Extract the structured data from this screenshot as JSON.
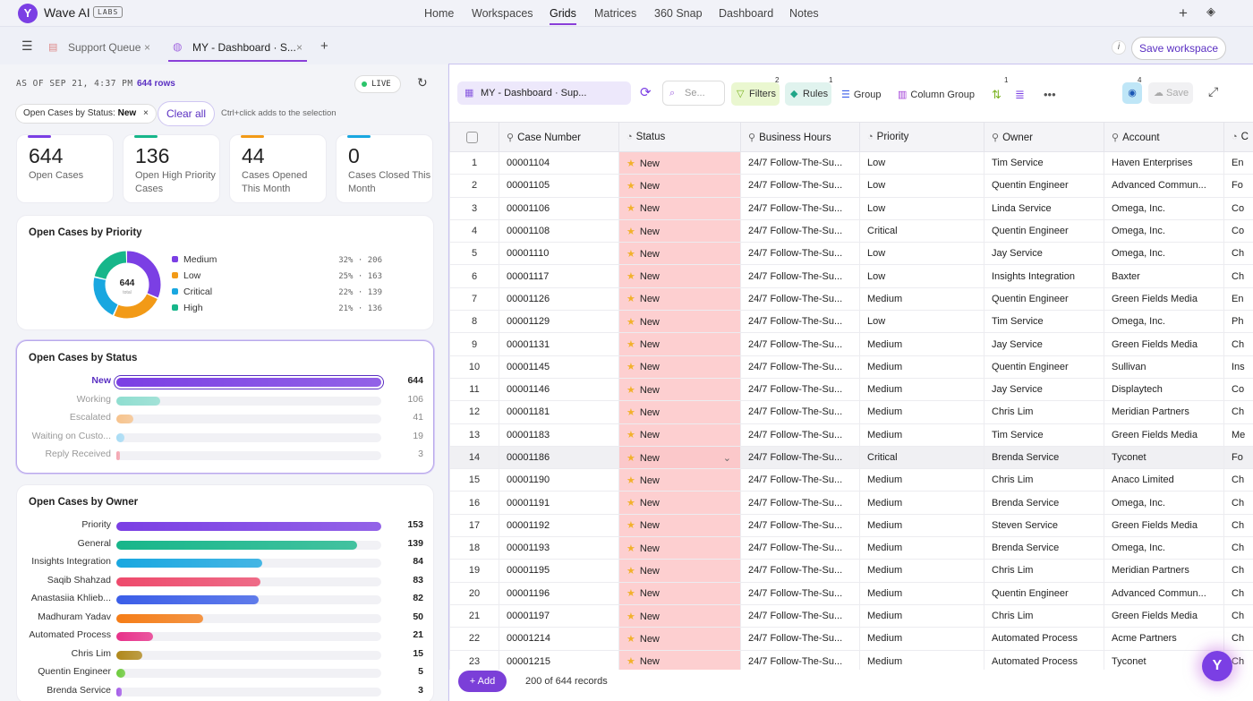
{
  "app": {
    "name": "Wave AI",
    "badge": "LABS"
  },
  "nav": [
    "Home",
    "Workspaces",
    "Grids",
    "Matrices",
    "360 Snap",
    "Dashboard",
    "Notes"
  ],
  "tabs": [
    {
      "label": "Support Queue",
      "active": false
    },
    {
      "label": "MY - Dashboard · S...",
      "active": true
    }
  ],
  "save_workspace": "Save workspace",
  "left": {
    "as_of": "AS OF SEP 21, 4:37 PM",
    "rows": "644 rows",
    "live": "LIVE",
    "filter_chip_label": "Open Cases by Status:",
    "filter_chip_value": "New",
    "clear_all": "Clear all",
    "hint": "Ctrl+click adds to the selection",
    "kpis": [
      {
        "value": "644",
        "label": "Open Cases",
        "color": "#7b3fe4"
      },
      {
        "value": "136",
        "label": "Open High Priority Cases",
        "color": "#17b68a"
      },
      {
        "value": "44",
        "label": "Cases Opened This Month",
        "color": "#f29a17"
      },
      {
        "value": "0",
        "label": "Cases Closed This Month",
        "color": "#19a7e0"
      }
    ],
    "priority_card": {
      "title": "Open Cases by Priority",
      "center_value": "644",
      "center_label": "total",
      "items": [
        {
          "name": "Medium",
          "pct": 32,
          "text": "32% · 206",
          "color": "#7b3fe4"
        },
        {
          "name": "Low",
          "pct": 25,
          "text": "25% · 163",
          "color": "#f29a17"
        },
        {
          "name": "Critical",
          "pct": 22,
          "text": "22% · 139",
          "color": "#19a7e0"
        },
        {
          "name": "High",
          "pct": 21,
          "text": "21% · 136",
          "color": "#17b68a"
        }
      ]
    },
    "status_card": {
      "title": "Open Cases by Status",
      "max": 644,
      "items": [
        {
          "name": "New",
          "value": 644,
          "color": "#7b3fe4"
        },
        {
          "name": "Working",
          "value": 106,
          "color": "#8fded0"
        },
        {
          "name": "Escalated",
          "value": 41,
          "color": "#f7c38c"
        },
        {
          "name": "Waiting on Custo...",
          "value": 19,
          "color": "#a8dcf5"
        },
        {
          "name": "Reply Received",
          "value": 3,
          "color": "#f5a4b0"
        }
      ]
    },
    "owner_card": {
      "title": "Open Cases by Owner",
      "max": 153,
      "items": [
        {
          "name": "Priority",
          "value": 153,
          "color": "#7b3fe4"
        },
        {
          "name": "General",
          "value": 139,
          "color": "#17b68a"
        },
        {
          "name": "Insights Integration",
          "value": 84,
          "color": "#19a7e0"
        },
        {
          "name": "Saqib Shahzad",
          "value": 83,
          "color": "#ee4a6c"
        },
        {
          "name": "Anastasiia Khlieb...",
          "value": 82,
          "color": "#3b5ee8"
        },
        {
          "name": "Madhuram Yadav",
          "value": 50,
          "color": "#f57d17"
        },
        {
          "name": "Automated Process",
          "value": 21,
          "color": "#e8318a"
        },
        {
          "name": "Chris Lim",
          "value": 15,
          "color": "#b0881a"
        },
        {
          "name": "Quentin Engineer",
          "value": 5,
          "color": "#6ccb3a"
        },
        {
          "name": "Brenda Service",
          "value": 3,
          "color": "#a45ce8"
        }
      ]
    }
  },
  "grid": {
    "name": "MY - Dashboard · Sup...",
    "search_placeholder": "Se...",
    "toolbar": {
      "filters": "Filters",
      "filters_badge": "2",
      "rules": "Rules",
      "rules_badge": "1",
      "group": "Group",
      "column_group": "Column Group",
      "sort_badge": "1",
      "eye_badge": "4",
      "save": "Save"
    },
    "columns": [
      "Case Number",
      "Status",
      "Business Hours",
      "Priority",
      "Owner",
      "Account",
      "C"
    ],
    "rows": [
      [
        "1",
        "00001104",
        "New",
        "24/7 Follow-The-Su...",
        "Low",
        "Tim Service",
        "Haven Enterprises",
        "En"
      ],
      [
        "2",
        "00001105",
        "New",
        "24/7 Follow-The-Su...",
        "Low",
        "Quentin Engineer",
        "Advanced Commun...",
        "Fo"
      ],
      [
        "3",
        "00001106",
        "New",
        "24/7 Follow-The-Su...",
        "Low",
        "Linda Service",
        "Omega, Inc.",
        "Co"
      ],
      [
        "4",
        "00001108",
        "New",
        "24/7 Follow-The-Su...",
        "Critical",
        "Quentin Engineer",
        "Omega, Inc.",
        "Co"
      ],
      [
        "5",
        "00001110",
        "New",
        "24/7 Follow-The-Su...",
        "Low",
        "Jay Service",
        "Omega, Inc.",
        "Ch"
      ],
      [
        "6",
        "00001117",
        "New",
        "24/7 Follow-The-Su...",
        "Low",
        "Insights Integration",
        "Baxter",
        "Ch"
      ],
      [
        "7",
        "00001126",
        "New",
        "24/7 Follow-The-Su...",
        "Medium",
        "Quentin Engineer",
        "Green Fields Media",
        "En"
      ],
      [
        "8",
        "00001129",
        "New",
        "24/7 Follow-The-Su...",
        "Low",
        "Tim Service",
        "Omega, Inc.",
        "Ph"
      ],
      [
        "9",
        "00001131",
        "New",
        "24/7 Follow-The-Su...",
        "Medium",
        "Jay Service",
        "Green Fields Media",
        "Ch"
      ],
      [
        "10",
        "00001145",
        "New",
        "24/7 Follow-The-Su...",
        "Medium",
        "Quentin Engineer",
        "Sullivan",
        "Ins"
      ],
      [
        "11",
        "00001146",
        "New",
        "24/7 Follow-The-Su...",
        "Medium",
        "Jay Service",
        "Displaytech",
        "Co"
      ],
      [
        "12",
        "00001181",
        "New",
        "24/7 Follow-The-Su...",
        "Medium",
        "Chris Lim",
        "Meridian Partners",
        "Ch"
      ],
      [
        "13",
        "00001183",
        "New",
        "24/7 Follow-The-Su...",
        "Medium",
        "Tim Service",
        "Green Fields Media",
        "Me"
      ],
      [
        "14",
        "00001186",
        "New",
        "24/7 Follow-The-Su...",
        "Critical",
        "Brenda Service",
        "Tyconet",
        "Fo"
      ],
      [
        "15",
        "00001190",
        "New",
        "24/7 Follow-The-Su...",
        "Medium",
        "Chris Lim",
        "Anaco Limited",
        "Ch"
      ],
      [
        "16",
        "00001191",
        "New",
        "24/7 Follow-The-Su...",
        "Medium",
        "Brenda Service",
        "Omega, Inc.",
        "Ch"
      ],
      [
        "17",
        "00001192",
        "New",
        "24/7 Follow-The-Su...",
        "Medium",
        "Steven Service",
        "Green Fields Media",
        "Ch"
      ],
      [
        "18",
        "00001193",
        "New",
        "24/7 Follow-The-Su...",
        "Medium",
        "Brenda Service",
        "Omega, Inc.",
        "Ch"
      ],
      [
        "19",
        "00001195",
        "New",
        "24/7 Follow-The-Su...",
        "Medium",
        "Chris Lim",
        "Meridian Partners",
        "Ch"
      ],
      [
        "20",
        "00001196",
        "New",
        "24/7 Follow-The-Su...",
        "Medium",
        "Quentin Engineer",
        "Advanced Commun...",
        "Ch"
      ],
      [
        "21",
        "00001197",
        "New",
        "24/7 Follow-The-Su...",
        "Medium",
        "Chris Lim",
        "Green Fields Media",
        "Ch"
      ],
      [
        "22",
        "00001214",
        "New",
        "24/7 Follow-The-Su...",
        "Medium",
        "Automated Process",
        "Acme Partners",
        "Ch"
      ],
      [
        "23",
        "00001215",
        "New",
        "24/7 Follow-The-Su...",
        "Medium",
        "Automated Process",
        "Tyconet",
        "Ch"
      ]
    ],
    "add": "+ Add",
    "record_count": "200 of 644 records"
  }
}
